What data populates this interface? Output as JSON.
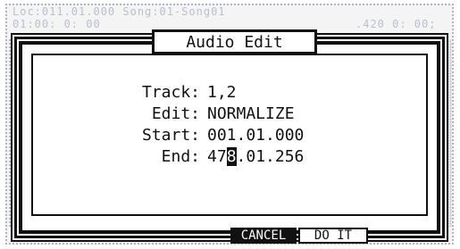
{
  "status": {
    "line1": "Loc:011.01.000  Song:01-Song01",
    "line2_left": "01:00: 0: 00",
    "line2_right": ".420 0: 00;"
  },
  "dialog": {
    "title": "Audio Edit",
    "fields": [
      {
        "label": "Track:",
        "value": "1,2"
      },
      {
        "label": "Edit:",
        "value": "NORMALIZE"
      },
      {
        "label": "Start:",
        "value": "001.01.000"
      },
      {
        "label": "End:",
        "value_before": "47",
        "value_cursor": "8",
        "value_after": ".01.256"
      }
    ]
  },
  "buttons": {
    "cancel": "CANCEL",
    "do_it": "DO IT"
  }
}
